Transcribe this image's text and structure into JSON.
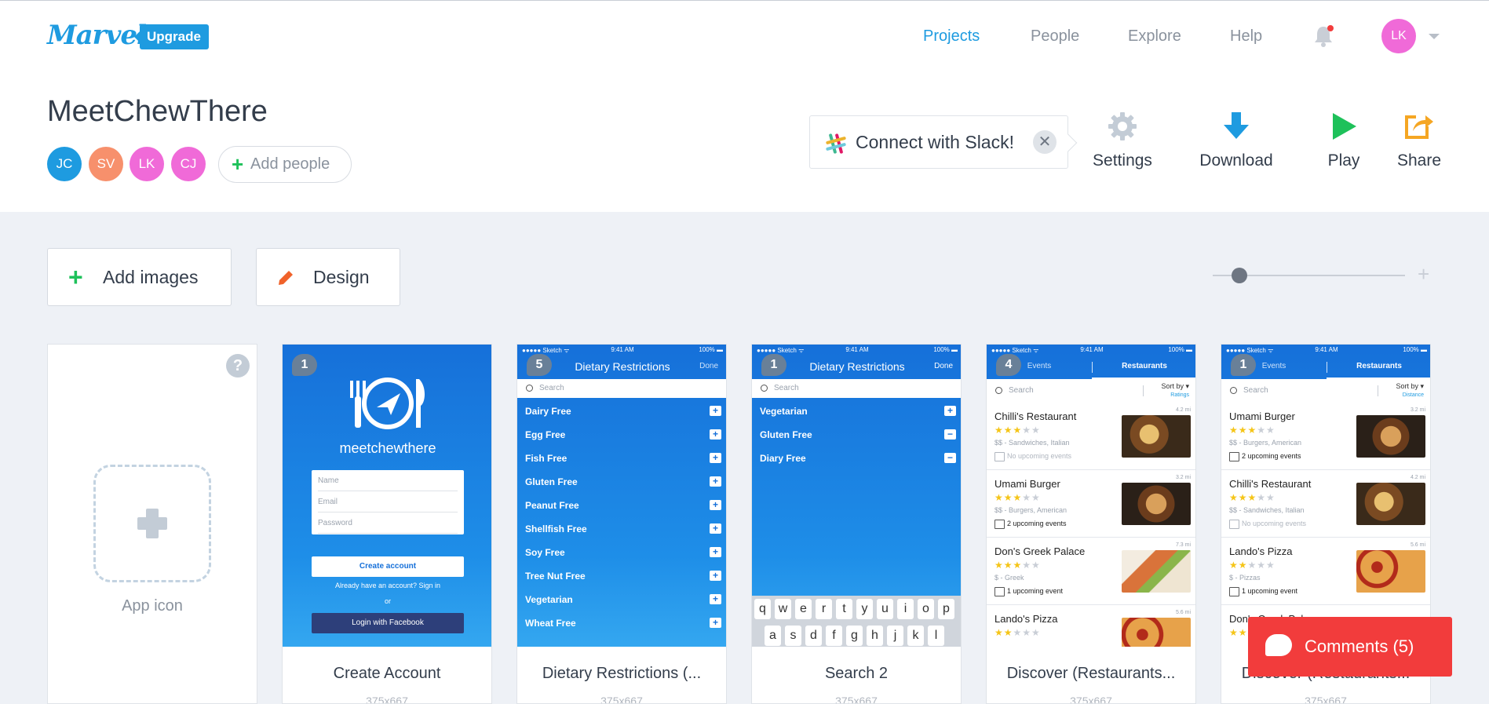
{
  "brand": {
    "logo": "Marvel",
    "upgrade": "Upgrade"
  },
  "nav": [
    "Projects",
    "People",
    "Explore",
    "Help"
  ],
  "user": {
    "initials": "LK"
  },
  "project": {
    "title": "MeetChewThere",
    "members": [
      {
        "initials": "JC",
        "color": "#1e9be0"
      },
      {
        "initials": "SV",
        "color": "#f7906c"
      },
      {
        "initials": "LK",
        "color": "#f06ad8"
      },
      {
        "initials": "CJ",
        "color": "#f06ad8"
      }
    ],
    "add_people": "Add people"
  },
  "slack": {
    "label": "Connect with Slack!"
  },
  "actions": {
    "settings": "Settings",
    "download": "Download",
    "play": "Play",
    "share": "Share"
  },
  "toolbar": {
    "add_images": "Add images",
    "design": "Design"
  },
  "app_icon": {
    "label": "App icon",
    "help": "?"
  },
  "cards": [
    {
      "name": "Create Account",
      "size": "375x667",
      "comments": "1"
    },
    {
      "name": "Dietary Restrictions (...",
      "size": "375x667",
      "comments": "5"
    },
    {
      "name": "Search 2",
      "size": "375x667",
      "comments": "1"
    },
    {
      "name": "Discover (Restaurants...",
      "size": "375x667",
      "comments": "4"
    },
    {
      "name": "Discover (Restaurants...",
      "size": "375x667",
      "comments": "1"
    }
  ],
  "status_bar": {
    "carrier": "●●●●● Sketch ᯤ",
    "time": "9:41 AM",
    "battery": "100% ▬"
  },
  "create_account": {
    "brand": "meetchewthere",
    "fields": [
      "Name",
      "Email",
      "Password"
    ],
    "button": "Create account",
    "signin": "Already have an account? Sign in",
    "or": "or",
    "facebook": "Login with Facebook"
  },
  "dietary": {
    "title": "Dietary Restrictions",
    "done": "Done",
    "search": "Search",
    "items": [
      "Dairy Free",
      "Egg Free",
      "Fish Free",
      "Gluten Free",
      "Peanut Free",
      "Shellfish Free",
      "Soy Free",
      "Tree Nut Free",
      "Vegetarian",
      "Wheat Free"
    ]
  },
  "search2": {
    "title": "Dietary Restrictions",
    "done": "Done",
    "search": "Search",
    "items": [
      {
        "label": "Vegetarian",
        "sign": "+"
      },
      {
        "label": "Gluten Free",
        "sign": "−"
      },
      {
        "label": "Diary Free",
        "sign": "−"
      }
    ],
    "keys_row1": [
      "q",
      "w",
      "e",
      "r",
      "t",
      "y",
      "u",
      "i",
      "o",
      "p"
    ],
    "keys_row2": [
      "a",
      "s",
      "d",
      "f",
      "g",
      "h",
      "j",
      "k",
      "l"
    ]
  },
  "discover1": {
    "tab_events": "Events",
    "tab_restaurants": "Restaurants",
    "search": "Search",
    "sort": "Sort by",
    "sort_value": "Ratings",
    "items": [
      {
        "name": "Chilli's Restaurant",
        "stars": 3,
        "cuisine": "$$ - Sandwiches, Italian",
        "events": "No upcoming events",
        "dist": "4.2 mi"
      },
      {
        "name": "Umami Burger",
        "stars": 3,
        "cuisine": "$$ - Burgers, American",
        "events": "2 upcoming events",
        "dist": "3.2 mi"
      },
      {
        "name": "Don's Greek Palace",
        "stars": 3,
        "cuisine": "$ - Greek",
        "events": "1 upcoming event",
        "dist": "7.3 mi"
      },
      {
        "name": "Lando's Pizza",
        "stars": 2,
        "cuisine": "",
        "events": "",
        "dist": "5.6 mi"
      }
    ]
  },
  "discover2": {
    "tab_events": "Events",
    "tab_restaurants": "Restaurants",
    "search": "Search",
    "sort": "Sort by",
    "sort_value": "Distance",
    "items": [
      {
        "name": "Umami Burger",
        "stars": 3,
        "cuisine": "$$ - Burgers, American",
        "events": "2 upcoming events",
        "dist": "3.2 mi"
      },
      {
        "name": "Chilli's Restaurant",
        "stars": 3,
        "cuisine": "$$ - Sandwiches, Italian",
        "events": "No upcoming events",
        "dist": "4.2 mi"
      },
      {
        "name": "Lando's Pizza",
        "stars": 2,
        "cuisine": "$ - Pizzas",
        "events": "1 upcoming event",
        "dist": "5.6 mi"
      },
      {
        "name": "Don's Greek Palace",
        "stars": 2,
        "cuisine": "",
        "events": "",
        "dist": ""
      }
    ]
  },
  "comments": {
    "label": "Comments (5)"
  },
  "colors": {
    "accent": "#1e9be0",
    "comments": "#f23c3c",
    "green": "#1ec15a",
    "orange": "#f0622a",
    "gear": "#c3ccd6"
  }
}
